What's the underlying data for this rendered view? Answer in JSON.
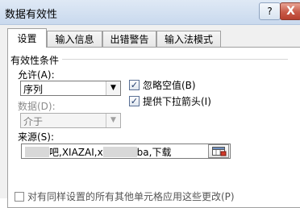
{
  "window": {
    "title": "数据有效性",
    "help_label": "?",
    "close_label": "X"
  },
  "tabs": [
    {
      "label": "设置",
      "active": true
    },
    {
      "label": "输入信息",
      "active": false
    },
    {
      "label": "出错警告",
      "active": false
    },
    {
      "label": "输入法模式",
      "active": false
    }
  ],
  "settings": {
    "group_title": "有效性条件",
    "allow_label": "允许(A):",
    "allow_value": "序列",
    "data_label": "数据(D):",
    "data_value": "介于",
    "ignore_blank_label": "忽略空值(B)",
    "ignore_blank_checked": true,
    "dropdown_label": "提供下拉箭头(I)",
    "dropdown_checked": true,
    "source_label": "来源(S):",
    "source_value_part1": "吧,XIAZAI,x",
    "source_value_part2": "ba,下载",
    "apply_all_label": "对有同样设置的所有其他单元格应用这些更改(P)"
  },
  "icons": {
    "range_select": "range-select-icon",
    "check": "checkmark-icon",
    "dropdown": "chevron-down-icon"
  }
}
